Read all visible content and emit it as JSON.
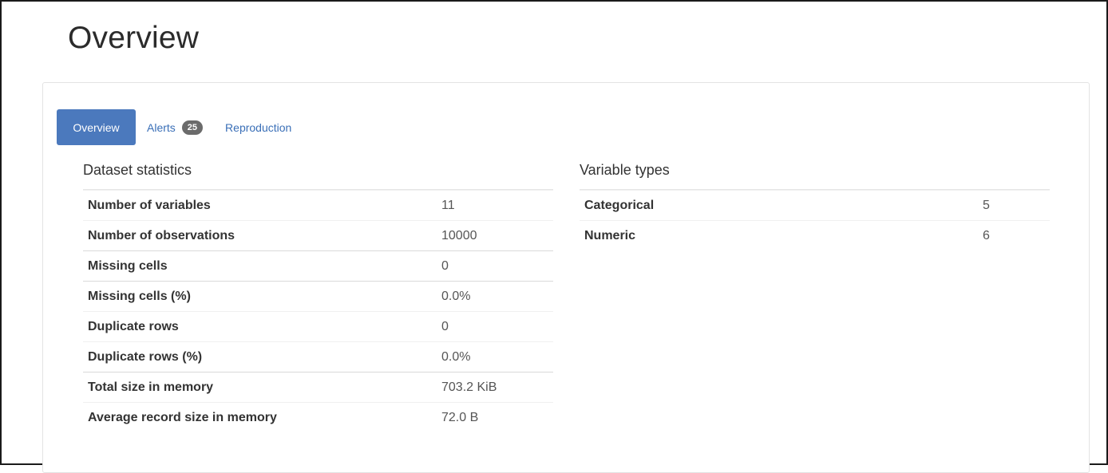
{
  "page": {
    "title": "Overview"
  },
  "tabs": [
    {
      "label": "Overview",
      "active": true
    },
    {
      "label": "Alerts",
      "badge": "25"
    },
    {
      "label": "Reproduction"
    }
  ],
  "dataset_statistics": {
    "title": "Dataset statistics",
    "rows": [
      {
        "label": "Number of variables",
        "value": "11"
      },
      {
        "label": "Number of observations",
        "value": "10000"
      },
      {
        "label": "Missing cells",
        "value": "0"
      },
      {
        "label": "Missing cells (%)",
        "value": "0.0%"
      },
      {
        "label": "Duplicate rows",
        "value": "0"
      },
      {
        "label": "Duplicate rows (%)",
        "value": "0.0%"
      },
      {
        "label": "Total size in memory",
        "value": "703.2 KiB"
      },
      {
        "label": "Average record size in memory",
        "value": "72.0 B"
      }
    ]
  },
  "variable_types": {
    "title": "Variable types",
    "rows": [
      {
        "label": "Categorical",
        "value": "5"
      },
      {
        "label": "Numeric",
        "value": "6"
      }
    ]
  },
  "colors": {
    "accent": "#4b79bd",
    "link": "#3a6fb7",
    "badge": "#6b6b6b"
  }
}
